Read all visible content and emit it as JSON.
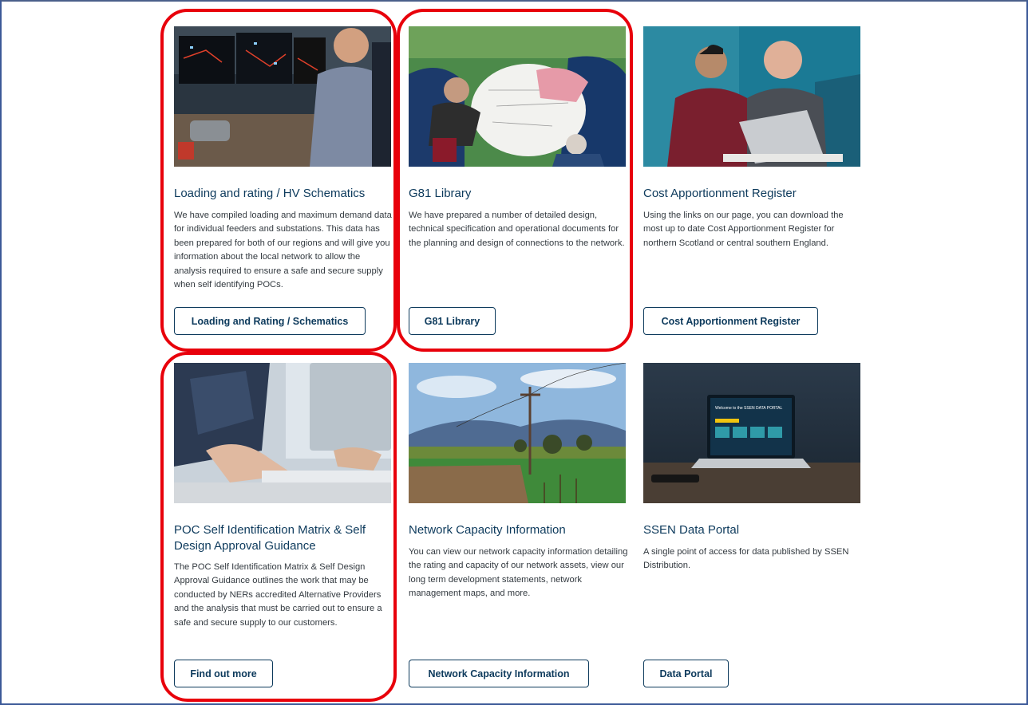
{
  "cards": [
    {
      "title": "Loading and rating / HV Schematics",
      "description": "We have compiled loading and maximum demand data for individual feeders and substations. This data has been prepared for both of our regions and will give you information about the local network to allow the analysis required to ensure a safe and secure supply when self identifying POCs.",
      "button": "Loading and Rating / Schematics",
      "image": "control-room-photo"
    },
    {
      "title": "G81 Library",
      "description": "We have prepared a number of detailed design, technical specification and operational documents for the planning and design of connections to the network.",
      "button": "G81 Library",
      "image": "design-meeting-photo"
    },
    {
      "title": "Cost Apportionment Register",
      "description": "Using the links on our page, you can download the most up to date Cost Apportionment Register for northern Scotland or central southern England.",
      "button": "Cost Apportionment Register",
      "image": "laptop-colleagues-photo"
    },
    {
      "title": "POC Self Identification Matrix & Self Design Approval Guidance",
      "description": "The POC Self Identification Matrix & Self Design Approval Guidance outlines the work that may be conducted by NERs accredited Alternative Providers and the analysis that must be carried out to ensure a safe and secure supply to our customers.",
      "button": "Find out more",
      "image": "typing-hands-photo"
    },
    {
      "title": "Network Capacity Information",
      "description": "You can view our network capacity information detailing the rating and capacity of our network assets, view our long term development statements, network management maps, and more.",
      "button": "Network Capacity Information",
      "image": "power-lines-landscape-photo"
    },
    {
      "title": "SSEN Data Portal",
      "description": "A single point of access for data published by SSEN Distribution.",
      "button": "Data Portal",
      "image": "data-portal-laptop-photo",
      "screen_text": "Welcome to the SSEN DATA PORTAL"
    }
  ],
  "colors": {
    "heading": "#0d3a5c",
    "highlight": "#e8000b",
    "frame": "#3b5998"
  }
}
